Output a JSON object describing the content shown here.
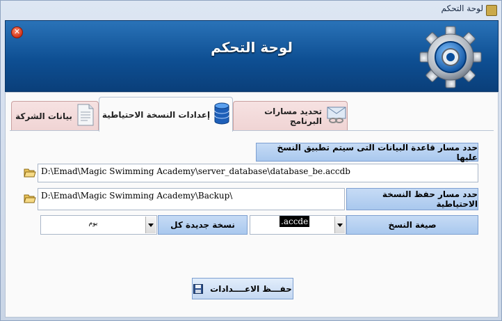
{
  "window": {
    "title": "لوحة التحكم"
  },
  "banner": {
    "title": "لوحة التحكم",
    "close_glyph": "✕"
  },
  "tabs": [
    {
      "label": "تحديد مسارات البرنامج",
      "icon": "envelope-chain-icon"
    },
    {
      "label": "إعدادات النسخة الاحتياطية",
      "icon": "database-icon",
      "active": true
    },
    {
      "label": "بيانات الشركة",
      "icon": "document-icon"
    }
  ],
  "backup": {
    "db_path_label": "حدد مسار قاعدة البيانات التى سيتم تطبيق النسخ عليها",
    "db_path_value": "D:\\Emad\\Magic Swimming Academy\\server_database\\database_be.accdb",
    "backup_path_label": "حدد مسار حفظ النسخة الاحتياطية",
    "backup_path_value": "D:\\Emad\\Magic Swimming Academy\\Backup\\",
    "format_label": "صيغة النسخ",
    "format_value": ".accde",
    "new_copy_label": "نسخة جديدة كل",
    "new_copy_value": "يوم",
    "save_label": "حفـــظ الاعــــدادات"
  },
  "colors": {
    "banner": "#0e4f93",
    "label_bg": "#b6d0f1",
    "tab_inactive": "#f3dada"
  }
}
